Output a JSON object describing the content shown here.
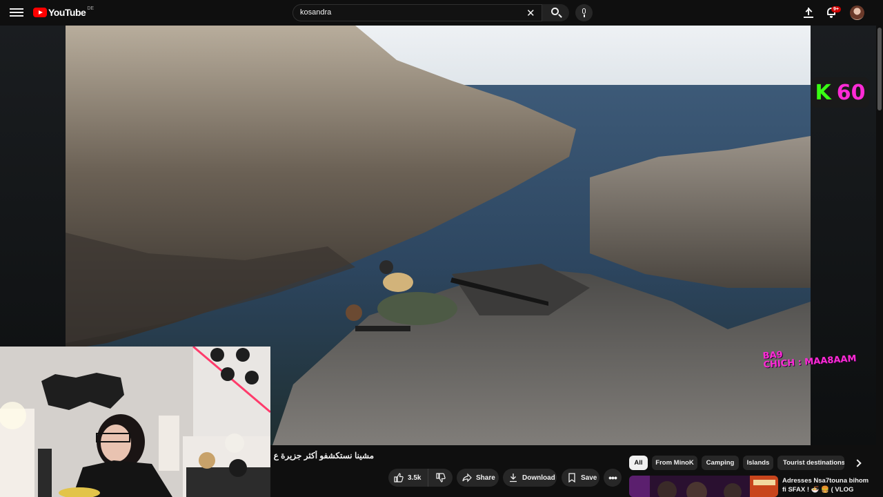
{
  "header": {
    "logo_text": "YouTube",
    "logo_region": "DE",
    "search_value": "kosandra",
    "notification_count": "9+"
  },
  "video": {
    "title": "مشينا نستكشفو أكثر جزيرة ع 😱",
    "overlay_counter_letter": "K",
    "overlay_counter_number": "60",
    "overlay_chat_line1": "BA9",
    "overlay_chat_line2": "CHICH : MAA8AAM"
  },
  "actions": {
    "likes": "3.5k",
    "share": "Share",
    "download": "Download",
    "save": "Save"
  },
  "chips": [
    {
      "label": "All",
      "active": true
    },
    {
      "label": "From MinoK",
      "active": false
    },
    {
      "label": "Camping",
      "active": false
    },
    {
      "label": "Islands",
      "active": false
    },
    {
      "label": "Tourist destinations",
      "active": false
    }
  ],
  "recommendation": {
    "title": "Adresses Nsa7touna bihom fi SFAX ! 🍜 🍔 ( VLOG"
  },
  "colors": {
    "background": "#0f0f0f",
    "surface": "#272727",
    "brand_red": "#ff0000",
    "overlay_green": "#39ff14",
    "overlay_pink": "#ff2bd6"
  }
}
